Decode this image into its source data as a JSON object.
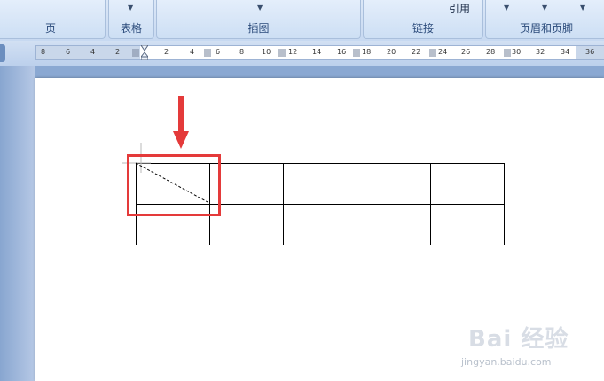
{
  "ribbon": {
    "groups": [
      {
        "label": "页"
      },
      {
        "label": "表格"
      },
      {
        "label": "插图"
      },
      {
        "label": "链接",
        "button": "引用"
      },
      {
        "label": "页眉和页脚"
      }
    ]
  },
  "ruler": {
    "ticks": [
      "8",
      "6",
      "4",
      "2",
      "2",
      "4",
      "6",
      "8",
      "10",
      "12",
      "14",
      "16",
      "18",
      "20",
      "22",
      "24",
      "26",
      "28",
      "30",
      "32",
      "34",
      "36"
    ]
  },
  "colors": {
    "highlight": "#e43a3a",
    "arrow": "#e43a3a"
  },
  "watermark": {
    "main": "Bai 经验",
    "sub": "jingyan.baidu.com"
  }
}
